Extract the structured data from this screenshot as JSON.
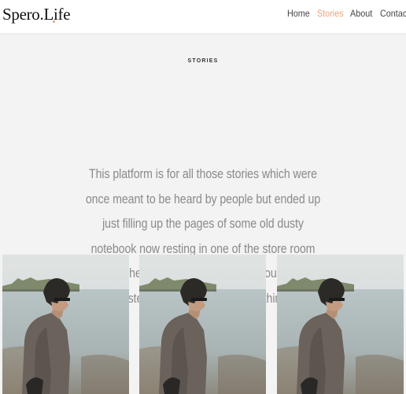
{
  "brand": {
    "logo_text": "Spero.Life",
    "dot_color": "#e9a27a"
  },
  "nav": {
    "items": [
      {
        "label": "Home",
        "active": false
      },
      {
        "label": "Stories",
        "active": true
      },
      {
        "label": "About",
        "active": false
      },
      {
        "label": "Contact",
        "active": false
      }
    ],
    "active_color": "#e9a27a",
    "default_color": "#444444"
  },
  "section": {
    "label": "STORIES",
    "intro": "This platform is for all those stories which were once meant to be heard by people but ended up just filling up the pages of some old dusty notebook now resting in one of the store room boxes. These three are people like you trying to take a step forward, towards something they wanted to do."
  },
  "cards": [
    {
      "image_description": "man-by-water-photo"
    },
    {
      "image_description": "man-by-water-photo"
    },
    {
      "image_description": "man-by-water-photo"
    }
  ],
  "colors": {
    "background": "#f3f3f3",
    "header_bg": "#ffffff",
    "intro_text": "#8a8a8a"
  }
}
